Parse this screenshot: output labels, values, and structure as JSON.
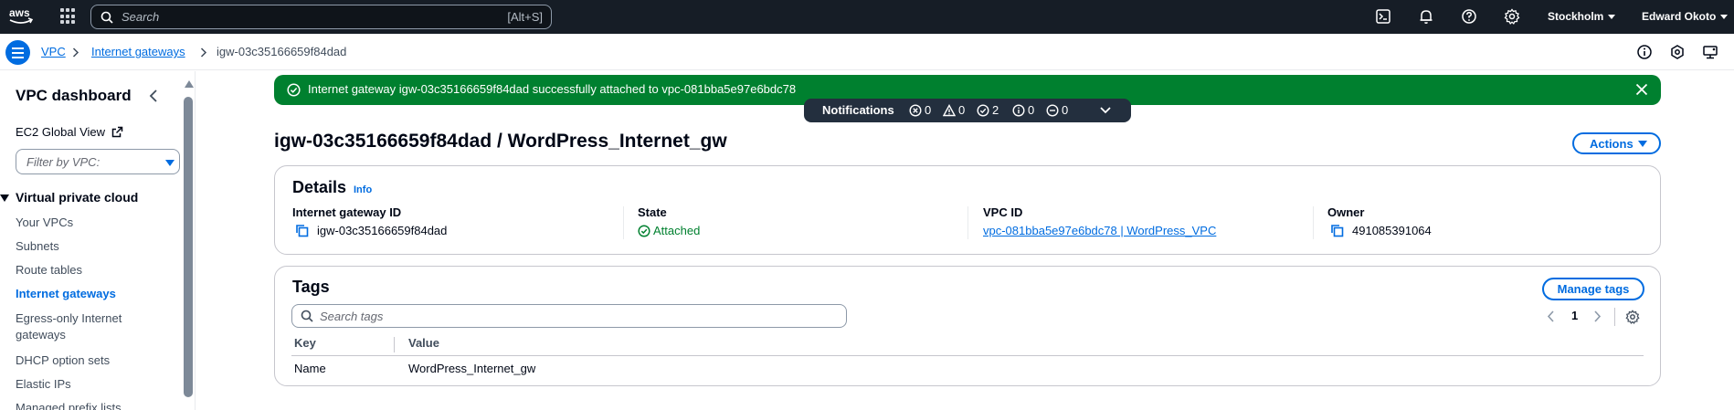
{
  "topnav": {
    "search_placeholder": "Search",
    "search_shortcut": "[Alt+S]",
    "region": "Stockholm",
    "user": "Edward Okoto"
  },
  "breadcrumb": {
    "items": [
      "VPC",
      "Internet gateways"
    ],
    "current": "igw-03c35166659f84dad"
  },
  "sidebar": {
    "title": "VPC dashboard",
    "ec2_link": "EC2 Global View",
    "filter_placeholder": "Filter by VPC:",
    "section": "Virtual private cloud",
    "items": [
      {
        "label": "Your VPCs",
        "active": false
      },
      {
        "label": "Subnets",
        "active": false
      },
      {
        "label": "Route tables",
        "active": false
      },
      {
        "label": "Internet gateways",
        "active": true
      },
      {
        "label": "Egress-only Internet gateways",
        "active": false
      },
      {
        "label": "DHCP option sets",
        "active": false
      },
      {
        "label": "Elastic IPs",
        "active": false
      },
      {
        "label": "Managed prefix lists",
        "active": false
      }
    ]
  },
  "flash": {
    "message": "Internet gateway igw-03c35166659f84dad successfully attached to vpc-081bba5e97e6bdc78",
    "color": "#00802f"
  },
  "notifications": {
    "title": "Notifications",
    "errors": "0",
    "warnings": "0",
    "success": "2",
    "info": "0",
    "in_progress": "0"
  },
  "page": {
    "title": "igw-03c35166659f84dad / WordPress_Internet_gw",
    "actions_label": "Actions"
  },
  "details": {
    "heading": "Details",
    "info": "Info",
    "gateway_id_label": "Internet gateway ID",
    "gateway_id": "igw-03c35166659f84dad",
    "state_label": "State",
    "state": "Attached",
    "vpc_id_label": "VPC ID",
    "vpc_id": "vpc-081bba5e97e6bdc78 | WordPress_VPC",
    "owner_label": "Owner",
    "owner": "491085391064"
  },
  "tags": {
    "heading": "Tags",
    "manage_label": "Manage tags",
    "search_placeholder": "Search tags",
    "page": "1",
    "columns": [
      "Key",
      "Value"
    ],
    "rows": [
      {
        "key": "Name",
        "value": "WordPress_Internet_gw"
      }
    ]
  },
  "colors": {
    "accent": "#006ce0",
    "nav_bg": "#161d26",
    "success": "#00802f"
  }
}
